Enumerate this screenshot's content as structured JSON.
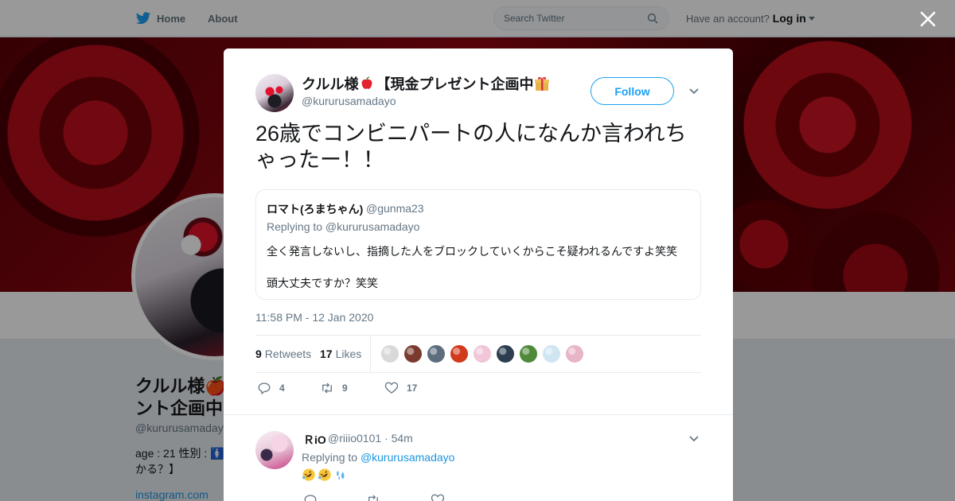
{
  "nav": {
    "home": "Home",
    "about": "About"
  },
  "search": {
    "placeholder": "Search Twitter"
  },
  "account": {
    "prompt": "Have an account?",
    "login": "Log in"
  },
  "profile": {
    "name_line1": "クルル様🍎【現金プレゼ",
    "name_line2": "ント企画中",
    "handle": "@kururusamadayo",
    "bio_line1": "age : 21 性別 : 🚺",
    "bio_line2": "かる？】",
    "link": "instagram.com"
  },
  "tweet": {
    "display_name": "クルル様",
    "display_name_suffix": "【現金プレゼント企画中",
    "handle": "@kururusamadayo",
    "follow_label": "Follow",
    "text": "26歳でコンビニパートの人になんか言われちゃったー！！",
    "quote": {
      "name": "ロマト(ろまちゃん)",
      "handle": "@gunma23",
      "replying": "Replying to @kururusamadayo",
      "line1": "全く発言しないし、指摘した人をブロックしていくからこそ疑われるんですよ笑笑",
      "line2": "頭大丈夫ですか？笑笑"
    },
    "timestamp": "11:58 PM - 12 Jan 2020",
    "retweets_count": "9",
    "retweets_label": "Retweets",
    "likes_count": "17",
    "likes_label": "Likes",
    "liker_colors": [
      "#d9d9d9",
      "#7a3b2e",
      "#5d6d7e",
      "#d13a1c",
      "#f0c6d8",
      "#2c3e50",
      "#4f8a3a",
      "#cfe6f2",
      "#e8b4c8"
    ],
    "actions": {
      "reply_count": "4",
      "retweet_count": "9",
      "like_count": "17"
    }
  },
  "reply": {
    "name": "ＲiO",
    "handle": "@riiio0101 · 54m",
    "replying_prefix": "Replying to ",
    "replying_to": "@kururusamadayo"
  }
}
